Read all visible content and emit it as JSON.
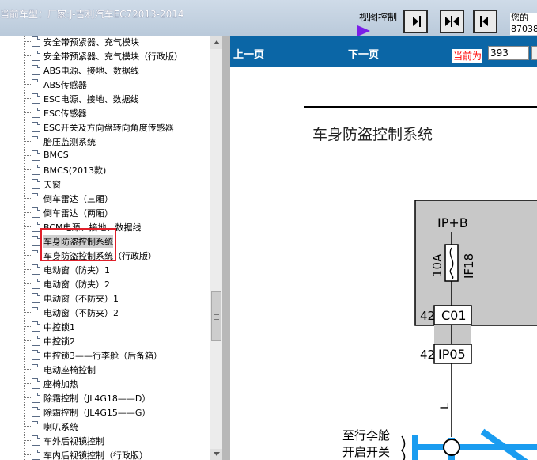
{
  "window": {
    "title": "当前车型：厂家:J-吉利汽车EC72013-2014",
    "view_control_label": "视图控制",
    "notice_lines": [
      "您的",
      "87038"
    ]
  },
  "tree": {
    "items": [
      {
        "label": "安全带预紧器、充气模块"
      },
      {
        "label": "安全带预紧器、充气模块（行政版）"
      },
      {
        "label": "ABS电源、接地、数据线"
      },
      {
        "label": "ABS传感器"
      },
      {
        "label": "ESC电源、接地、数据线"
      },
      {
        "label": "ESC传感器"
      },
      {
        "label": "ESC开关及方向盘转向角度传感器"
      },
      {
        "label": "胎压监测系统"
      },
      {
        "label": "BMCS"
      },
      {
        "label": "BMCS(2013款)"
      },
      {
        "label": "天窗"
      },
      {
        "label": "倒车雷达（三厢）"
      },
      {
        "label": "倒车雷达（两厢）"
      },
      {
        "label": "BCM电源、接地、数据线"
      },
      {
        "label": "车身防盗控制系统",
        "selected": true
      },
      {
        "label": "车身防盗控制系统（行政版）"
      },
      {
        "label": "电动窗（防夹）1"
      },
      {
        "label": "电动窗（防夹）2"
      },
      {
        "label": "电动窗（不防夹）1"
      },
      {
        "label": "电动窗（不防夹）2"
      },
      {
        "label": "中控锁1"
      },
      {
        "label": "中控锁2"
      },
      {
        "label": "中控锁3——行李舱（后备箱）"
      },
      {
        "label": "电动座椅控制"
      },
      {
        "label": "座椅加热"
      },
      {
        "label": "除霜控制（JL4G18——D）"
      },
      {
        "label": "除霜控制（JL4G15——G）"
      },
      {
        "label": "喇叭系统"
      },
      {
        "label": "车外后视镜控制"
      },
      {
        "label": "车内后视镜控制（行政版）"
      }
    ]
  },
  "viewer": {
    "prev_label": "上一页",
    "next_label": "下一页",
    "current_label": "当前为",
    "current_page": "393",
    "doc_title": "车身防盗控制系统",
    "diagram": {
      "power": "IP+B",
      "fuse_rating": "10A",
      "fuse_id": "IF18",
      "pin1": "42",
      "conn1": "C01",
      "pin2": "42",
      "conn2": "IP05",
      "wire_color": "L",
      "dest_line1": "至行李舱",
      "dest_line2": "开启开关"
    }
  },
  "colors": {
    "nav_bar": "#0b66a6",
    "highlight_box": "#e0202a",
    "wire": "#1a9cf0",
    "arrow": "#7a1ee8"
  }
}
